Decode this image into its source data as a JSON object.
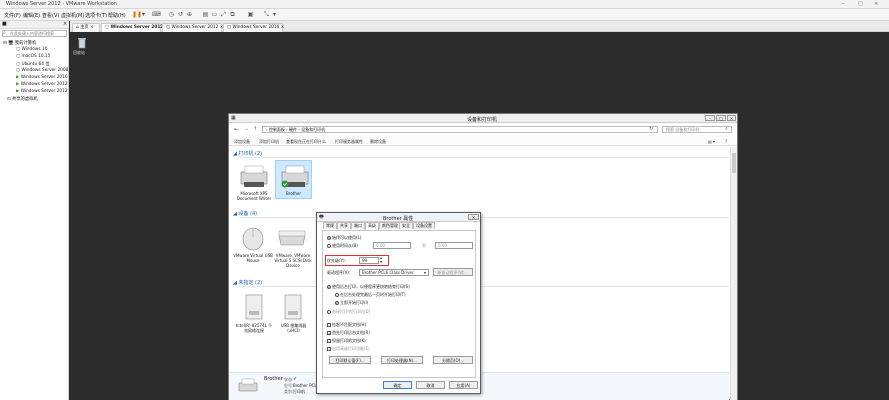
{
  "app": {
    "title": "Windows Server 2012 - VMware Workstation",
    "window_controls": [
      "–",
      "□",
      "×"
    ]
  },
  "menubar": {
    "items": [
      "文件(F)",
      "编辑(E)",
      "查看(V)",
      "虚拟机(M)",
      "选项卡(T)",
      "帮助(H)"
    ]
  },
  "sidebar": {
    "header_icon": "library-icon",
    "search_placeholder": "在此处键入内容进行搜索",
    "root": "我的计算机",
    "items": [
      "Windows 10",
      "macOS 10.15",
      "Ubuntu 64 位",
      "Windows Server 2008",
      "Windows Server 2016",
      "Windows Server 2012",
      "Windows Server 2012"
    ],
    "shared": "共享的虚拟机"
  },
  "tabs": {
    "items": [
      "主页",
      "Windows Server 2012",
      "Windows Server 2012",
      "Windows Server 2016"
    ]
  },
  "guest": {
    "recycle_bin": "回收站"
  },
  "devices_window": {
    "title": "设备和打印机",
    "address": "› 控制面板 › 硬件 › 设备和打印机",
    "search_placeholder": "搜索 设备和打印机",
    "commands": [
      "添加设备",
      "添加打印机",
      "查看现在正在打印什么",
      "打印服务器属性",
      "删除设备"
    ],
    "sections": {
      "printers": "打印机 (2)",
      "devices": "设备 (4)",
      "unspecified": "未指定 (2)"
    },
    "printers": [
      "Microsoft XPS Document Writer",
      "Brother"
    ],
    "devices": [
      "VMware Virtual USB Mouse",
      "VMware, VMware Virtual S SCSI Disk Device"
    ],
    "unspecified": [
      "Intel(R) 82574L 千兆网络连接",
      "USB 根集线器 (xHCI)"
    ],
    "details": {
      "name": "Brother",
      "state_label": "状态:",
      "model_label": "型号:",
      "model": "Brother PCL",
      "category_label": "类别:",
      "category": "打印机"
    }
  },
  "dialog": {
    "title": "Brother 属性",
    "tabs": [
      "常规",
      "共享",
      "端口",
      "高级",
      "颜色管理",
      "安全",
      "设备设置"
    ],
    "active_tab": "高级",
    "availability": {
      "always": "始终可以使用(L)",
      "from": "使用时间从(B)",
      "from_value": "0:00",
      "to_label": "到",
      "to_value": "0:00"
    },
    "priority": {
      "label": "优先级(Y):",
      "value": "99"
    },
    "driver": {
      "label": "驱动程序(V):",
      "value": "Brother PCL6 Class Driver",
      "new_button": "新驱动程序(W)..."
    },
    "spool": {
      "spool_option": "使用后台打印，以便程序更快地结束打印(S)",
      "after_last": "在后台处理完最后一页时开始打印(T)",
      "immediately": "立即开始打印(I)",
      "direct": "直接打印到打印机(D)"
    },
    "checks": [
      {
        "label": "挂起不匹配文档(H)",
        "checked": false
      },
      {
        "label": "首先打印后台文档(R)",
        "checked": true
      },
      {
        "label": "保留打印的文档(K)",
        "checked": false
      },
      {
        "label": "启用高级打印功能(E)",
        "checked": true
      }
    ],
    "buttons": {
      "defaults": "打印默认值(F)...",
      "processor": "打印处理器(N)...",
      "separator": "分隔页(O)...",
      "ok": "确定",
      "cancel": "取消",
      "apply": "应用(A)"
    },
    "colors": {
      "highlight": "#e03030",
      "accent": "#1d5fb0"
    }
  }
}
